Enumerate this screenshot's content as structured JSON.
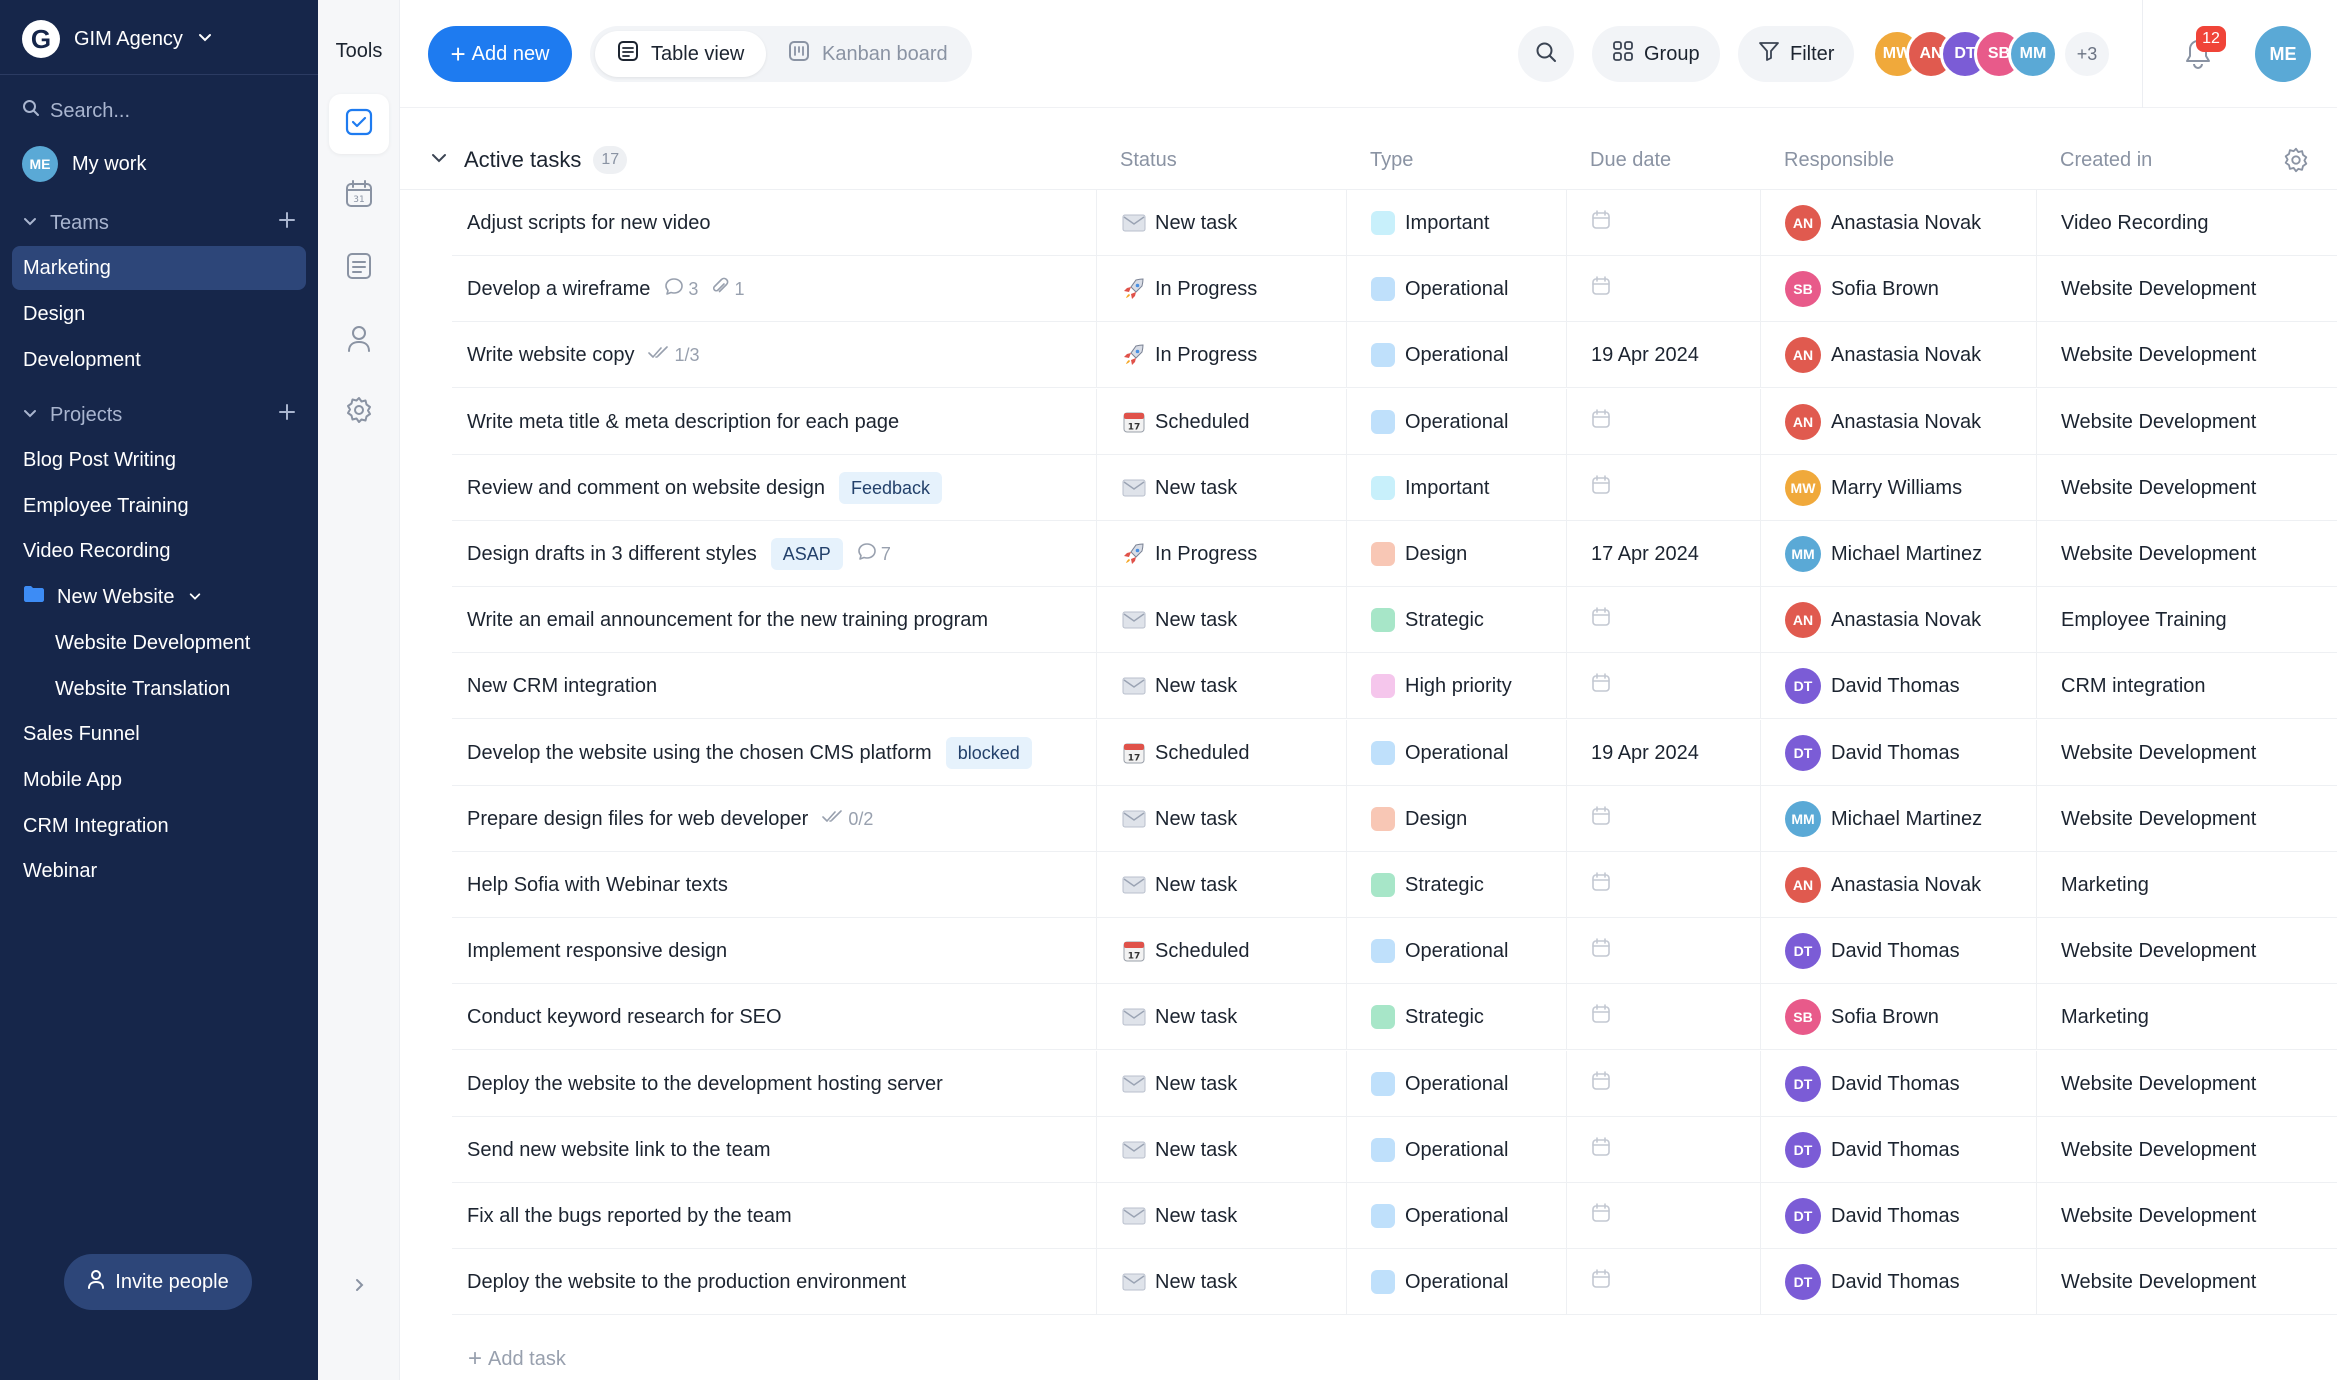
{
  "brand": {
    "logo_letter": "G",
    "name": "GIM Agency"
  },
  "sidebar": {
    "search_placeholder": "Search...",
    "my_work": {
      "label": "My work",
      "avatar_initials": "ME",
      "avatar_color": "#5aa9d6"
    },
    "teams": {
      "label": "Teams",
      "items": [
        {
          "label": "Marketing",
          "active": true
        },
        {
          "label": "Design"
        },
        {
          "label": "Development"
        }
      ]
    },
    "projects": {
      "label": "Projects",
      "items": [
        {
          "label": "Blog Post Writing"
        },
        {
          "label": "Employee Training"
        },
        {
          "label": "Video Recording"
        },
        {
          "label": "New Website",
          "folder": true
        },
        {
          "label": "Website Development",
          "sub": true
        },
        {
          "label": "Website Translation",
          "sub": true
        },
        {
          "label": "Sales Funnel"
        },
        {
          "label": "Mobile App"
        },
        {
          "label": "CRM Integration"
        },
        {
          "label": "Webinar"
        }
      ]
    },
    "invite_label": "Invite people"
  },
  "tools": {
    "title": "Tools",
    "items": [
      "tasks-icon",
      "calendar-icon",
      "notes-icon",
      "contacts-icon",
      "settings-icon"
    ]
  },
  "toolbar": {
    "add_new_label": "Add new",
    "views": [
      {
        "label": "Table view",
        "active": true,
        "icon": "table-icon"
      },
      {
        "label": "Kanban board",
        "active": false,
        "icon": "kanban-icon"
      }
    ],
    "group_label": "Group",
    "filter_label": "Filter",
    "members": [
      {
        "initials": "MW",
        "color": "#f0a93b"
      },
      {
        "initials": "AN",
        "color": "#e05a4f"
      },
      {
        "initials": "DT",
        "color": "#7b5cd6"
      },
      {
        "initials": "SB",
        "color": "#e85a8a"
      },
      {
        "initials": "MM",
        "color": "#5aa9d6"
      }
    ],
    "members_more": "+3",
    "notifications_count": "12",
    "user_avatar": {
      "initials": "ME",
      "color": "#5aa9d6"
    }
  },
  "table": {
    "group_title": "Active tasks",
    "count": "17",
    "columns": {
      "status": "Status",
      "type": "Type",
      "due": "Due date",
      "responsible": "Responsible",
      "created": "Created in"
    },
    "status_icons": {
      "New task": "envelope-icon",
      "In Progress": "rocket-icon",
      "Scheduled": "calendar-icon"
    },
    "type_colors": {
      "Important": "#c8f0fb",
      "Operational": "#bfe0fb",
      "Design": "#f8c7b5",
      "Strategic": "#a7e6c8",
      "High priority": "#f5c6ec"
    },
    "people": {
      "Anastasia Novak": {
        "initials": "AN",
        "color": "#e05a4f"
      },
      "Sofia Brown": {
        "initials": "SB",
        "color": "#e85a8a"
      },
      "Marry Williams": {
        "initials": "MW",
        "color": "#f0a93b"
      },
      "Michael Martinez": {
        "initials": "MM",
        "color": "#5aa9d6"
      },
      "David Thomas": {
        "initials": "DT",
        "color": "#7b5cd6"
      }
    },
    "rows": [
      {
        "title": "Adjust scripts for new video",
        "status": "New task",
        "type": "Important",
        "due": "",
        "responsible": "Anastasia Novak",
        "created": "Video Recording"
      },
      {
        "title": "Develop a wireframe",
        "comments": "3",
        "attachments": "1",
        "status": "In Progress",
        "type": "Operational",
        "due": "",
        "responsible": "Sofia Brown",
        "created": "Website Development"
      },
      {
        "title": "Write website copy",
        "checklist": "1/3",
        "status": "In Progress",
        "type": "Operational",
        "due": "19 Apr 2024",
        "responsible": "Anastasia Novak",
        "created": "Website Development"
      },
      {
        "title": "Write meta title & meta description for each page",
        "status": "Scheduled",
        "type": "Operational",
        "due": "",
        "responsible": "Anastasia Novak",
        "created": "Website Development"
      },
      {
        "title": "Review and comment on website design",
        "tag": "Feedback",
        "status": "New task",
        "type": "Important",
        "due": "",
        "responsible": "Marry Williams",
        "created": "Website Development"
      },
      {
        "title": "Design drafts in 3 different styles",
        "tag": "ASAP",
        "comments": "7",
        "status": "In Progress",
        "type": "Design",
        "due": "17 Apr 2024",
        "responsible": "Michael Martinez",
        "created": "Website Development"
      },
      {
        "title": "Write an email announcement for the new training program",
        "status": "New task",
        "type": "Strategic",
        "due": "",
        "responsible": "Anastasia Novak",
        "created": "Employee Training"
      },
      {
        "title": "New CRM integration",
        "status": "New task",
        "type": "High priority",
        "due": "",
        "responsible": "David Thomas",
        "created": "CRM integration"
      },
      {
        "title": "Develop the website using the chosen CMS platform",
        "tag": "blocked",
        "status": "Scheduled",
        "type": "Operational",
        "due": "19 Apr 2024",
        "responsible": "David Thomas",
        "created": "Website Development"
      },
      {
        "title": "Prepare design files for web developer",
        "checklist": "0/2",
        "status": "New task",
        "type": "Design",
        "due": "",
        "responsible": "Michael Martinez",
        "created": "Website Development"
      },
      {
        "title": "Help Sofia with Webinar texts",
        "status": "New task",
        "type": "Strategic",
        "due": "",
        "responsible": "Anastasia Novak",
        "created": "Marketing"
      },
      {
        "title": "Implement responsive design",
        "status": "Scheduled",
        "type": "Operational",
        "due": "",
        "responsible": "David Thomas",
        "created": "Website Development"
      },
      {
        "title": "Conduct keyword research for SEO",
        "status": "New task",
        "type": "Strategic",
        "due": "",
        "responsible": "Sofia Brown",
        "created": "Marketing"
      },
      {
        "title": "Deploy the website to the development hosting server",
        "status": "New task",
        "type": "Operational",
        "due": "",
        "responsible": "David Thomas",
        "created": "Website Development"
      },
      {
        "title": "Send new website link to the team",
        "status": "New task",
        "type": "Operational",
        "due": "",
        "responsible": "David Thomas",
        "created": "Website Development"
      },
      {
        "title": "Fix all the bugs reported by the team",
        "status": "New task",
        "type": "Operational",
        "due": "",
        "responsible": "David Thomas",
        "created": "Website Development"
      },
      {
        "title": "Deploy the website to the production environment",
        "status": "New task",
        "type": "Operational",
        "due": "",
        "responsible": "David Thomas",
        "created": "Website Development"
      }
    ],
    "add_task_label": "Add task"
  }
}
